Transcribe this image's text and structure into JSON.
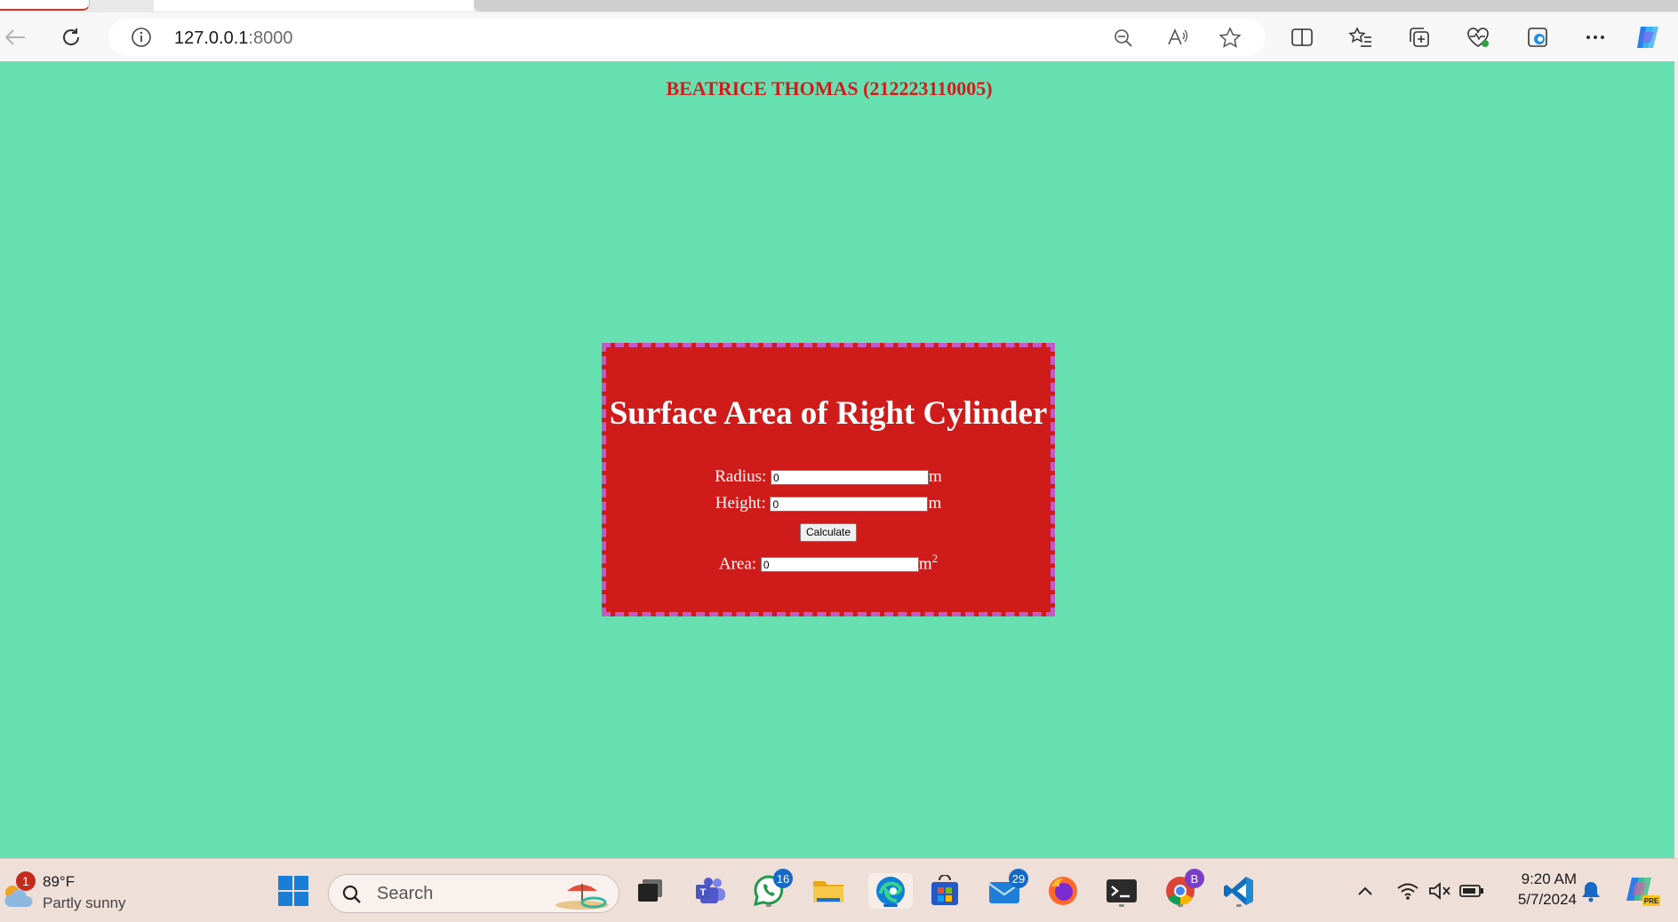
{
  "browser": {
    "url_host": "127.0.0.1",
    "url_port": ":8000"
  },
  "page": {
    "student_name": "BEATRICE THOMAS (212223110005)",
    "title": "Surface Area of Right Cylinder",
    "radius_label": "Radius:",
    "radius_value": "0",
    "radius_unit": "m",
    "height_label": "Height:",
    "height_value": "0",
    "height_unit": "m",
    "calculate_label": "Calculate",
    "area_label": "Area:",
    "area_value": "0",
    "area_unit": "m",
    "area_unit_exp": "2"
  },
  "taskbar": {
    "weather_temp": "89°F",
    "weather_desc": "Partly sunny",
    "weather_badge": "1",
    "search_placeholder": "Search",
    "whatsapp_badge": "16",
    "mail_badge": "29",
    "chrome_badge": "B",
    "time": "9:20 AM",
    "date": "5/7/2024"
  },
  "colors": {
    "page_bg": "#66e0b0",
    "box_bg": "#d01b1b",
    "box_border": "#c45ac6",
    "name_color": "#d21c1c"
  }
}
